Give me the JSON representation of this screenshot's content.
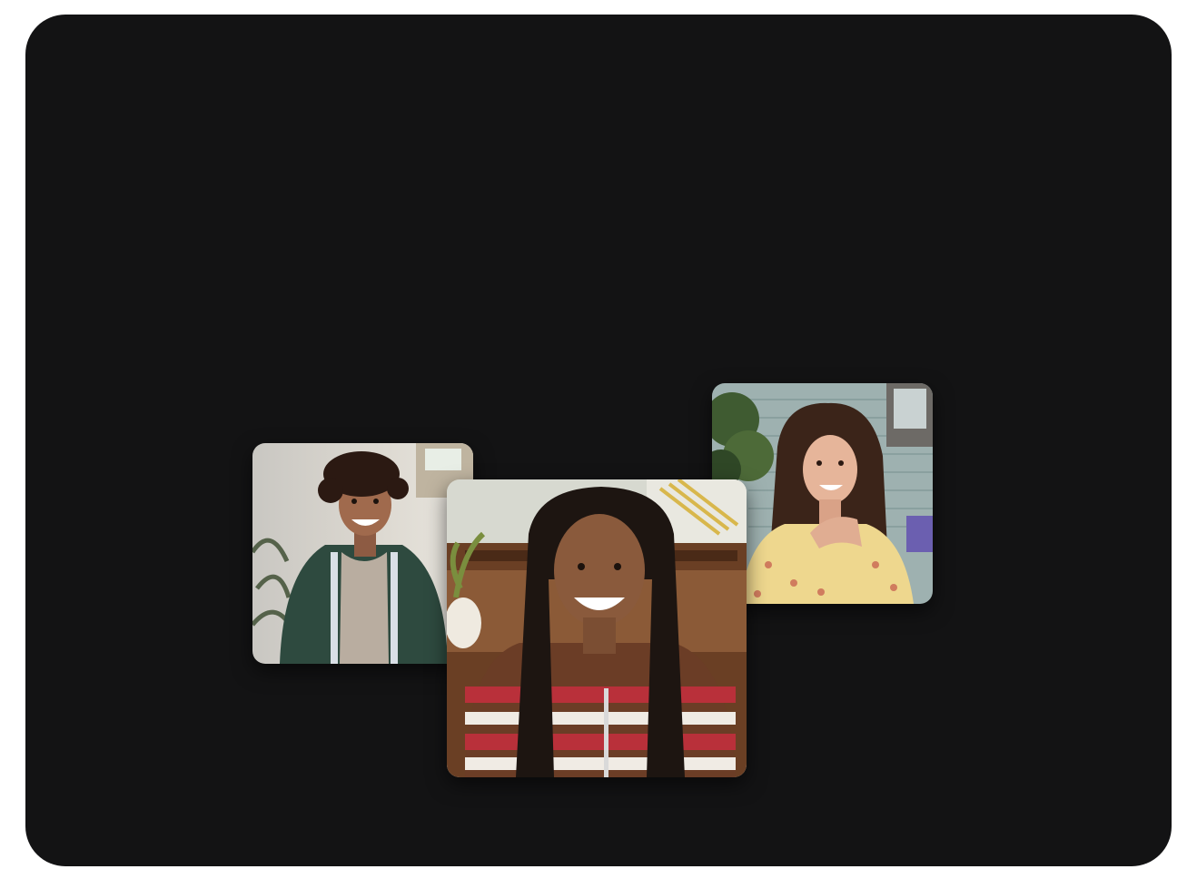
{
  "call": {
    "participants": [
      {
        "id": "left",
        "role": "participant-video"
      },
      {
        "id": "main",
        "role": "participant-video"
      },
      {
        "id": "right",
        "role": "participant-video"
      }
    ]
  },
  "theme": {
    "window_background": "#131314",
    "page_background": "#ffffff"
  }
}
